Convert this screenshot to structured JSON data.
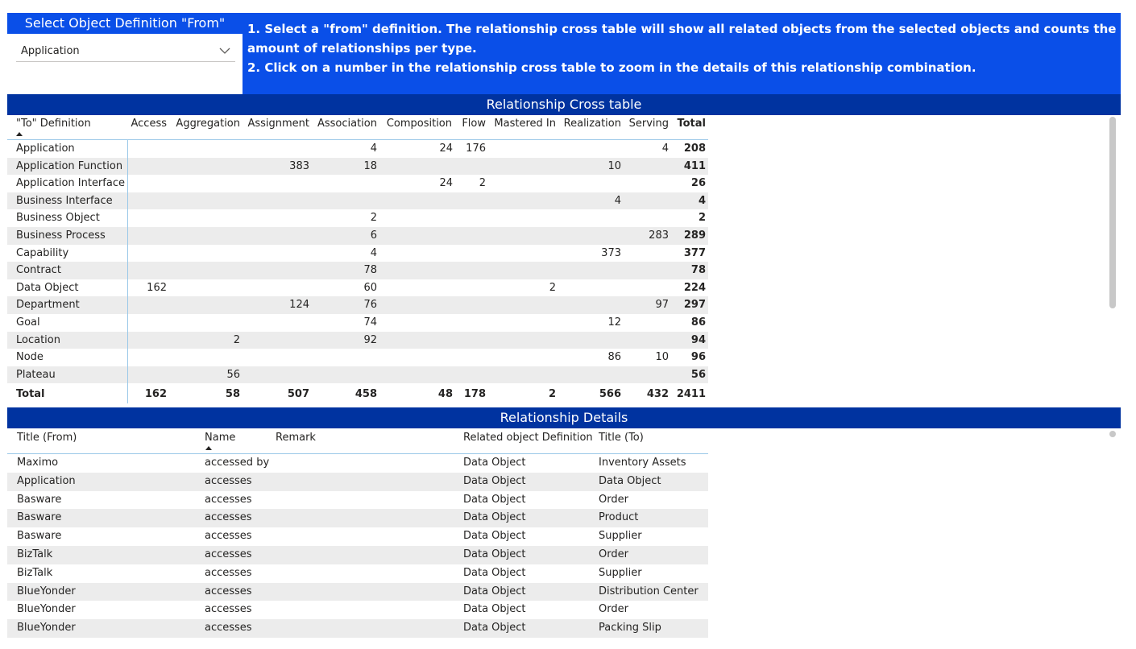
{
  "slicer": {
    "title": "Select Object Definition \"From\"",
    "selected": "Application",
    "chevron_icon": "chevron-down-icon"
  },
  "instructions": {
    "line1": "1. Select a \"from\" definition. The relationship cross table will show all related objects from the selected objects and counts the amount of relationships per type.",
    "line2": "2. Click on a number in the relationship cross table to zoom in the details of this relationship combination."
  },
  "cross_table": {
    "title": "Relationship Cross table",
    "row_header": "\"To\" Definition",
    "columns": [
      "Access",
      "Aggregation",
      "Assignment",
      "Association",
      "Composition",
      "Flow",
      "Mastered In",
      "Realization",
      "Serving",
      "Total"
    ],
    "rows": [
      {
        "label": "Application",
        "cells": [
          "",
          "",
          "",
          "4",
          "24",
          "176",
          "",
          "",
          "4",
          "208"
        ]
      },
      {
        "label": "Application Function",
        "cells": [
          "",
          "",
          "383",
          "18",
          "",
          "",
          "",
          "10",
          "",
          "411"
        ]
      },
      {
        "label": "Application Interface",
        "cells": [
          "",
          "",
          "",
          "",
          "24",
          "2",
          "",
          "",
          "",
          "26"
        ]
      },
      {
        "label": "Business Interface",
        "cells": [
          "",
          "",
          "",
          "",
          "",
          "",
          "",
          "4",
          "",
          "4"
        ]
      },
      {
        "label": "Business Object",
        "cells": [
          "",
          "",
          "",
          "2",
          "",
          "",
          "",
          "",
          "",
          "2"
        ]
      },
      {
        "label": "Business Process",
        "cells": [
          "",
          "",
          "",
          "6",
          "",
          "",
          "",
          "",
          "283",
          "289"
        ]
      },
      {
        "label": "Capability",
        "cells": [
          "",
          "",
          "",
          "4",
          "",
          "",
          "",
          "373",
          "",
          "377"
        ]
      },
      {
        "label": "Contract",
        "cells": [
          "",
          "",
          "",
          "78",
          "",
          "",
          "",
          "",
          "",
          "78"
        ]
      },
      {
        "label": "Data Object",
        "cells": [
          "162",
          "",
          "",
          "60",
          "",
          "",
          "2",
          "",
          "",
          "224"
        ]
      },
      {
        "label": "Department",
        "cells": [
          "",
          "",
          "124",
          "76",
          "",
          "",
          "",
          "",
          "97",
          "297"
        ]
      },
      {
        "label": "Goal",
        "cells": [
          "",
          "",
          "",
          "74",
          "",
          "",
          "",
          "12",
          "",
          "86"
        ]
      },
      {
        "label": "Location",
        "cells": [
          "",
          "2",
          "",
          "92",
          "",
          "",
          "",
          "",
          "",
          "94"
        ]
      },
      {
        "label": "Node",
        "cells": [
          "",
          "",
          "",
          "",
          "",
          "",
          "",
          "86",
          "10",
          "96"
        ]
      },
      {
        "label": "Plateau",
        "cells": [
          "",
          "56",
          "",
          "",
          "",
          "",
          "",
          "",
          "",
          "56"
        ]
      }
    ],
    "total": {
      "label": "Total",
      "cells": [
        "162",
        "58",
        "507",
        "458",
        "48",
        "178",
        "2",
        "566",
        "432",
        "2411"
      ]
    }
  },
  "details": {
    "title": "Relationship Details",
    "columns": [
      "Title (From)",
      "Name",
      "Remark",
      "Related object Definition",
      "Title (To)"
    ],
    "rows": [
      [
        "Maximo",
        "accessed by",
        "",
        "Data Object",
        "Inventory Assets"
      ],
      [
        "Application",
        "accesses",
        "",
        "Data Object",
        "Data Object"
      ],
      [
        "Basware",
        "accesses",
        "",
        "Data Object",
        "Order"
      ],
      [
        "Basware",
        "accesses",
        "",
        "Data Object",
        "Product"
      ],
      [
        "Basware",
        "accesses",
        "",
        "Data Object",
        "Supplier"
      ],
      [
        "BizTalk",
        "accesses",
        "",
        "Data Object",
        "Order"
      ],
      [
        "BizTalk",
        "accesses",
        "",
        "Data Object",
        "Supplier"
      ],
      [
        "BlueYonder",
        "accesses",
        "",
        "Data Object",
        "Distribution Center"
      ],
      [
        "BlueYonder",
        "accesses",
        "",
        "Data Object",
        "Order"
      ],
      [
        "BlueYonder",
        "accesses",
        "",
        "Data Object",
        "Packing Slip"
      ]
    ]
  }
}
